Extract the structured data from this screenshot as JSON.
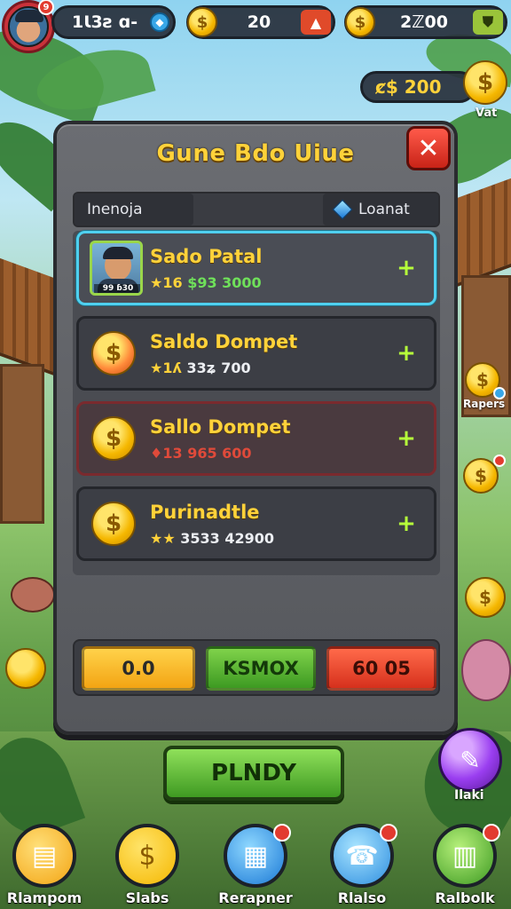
{
  "topbar": {
    "avatar_badge": "9",
    "player_value": "1Ɩ3ƨ ɑ-",
    "coins_value": "20",
    "gold_value": "2ℤ00"
  },
  "floating_chip": {
    "value": "ȼ$ 200",
    "label": "Vat"
  },
  "panel": {
    "title": "Gune Bdo Uiue",
    "close_symbol": "✕",
    "tabs": [
      {
        "label": "Inenoja"
      },
      {
        "label": "Loanat"
      }
    ],
    "rows": [
      {
        "title": "Sado Patal",
        "portrait_tag": "99 ɓ30",
        "sub_prefix": "★16",
        "sub_value": "$93 3000",
        "plus": "+"
      },
      {
        "title": "Saldo Dompet",
        "sub_prefix": "★1ʎ",
        "sub_value": "33ʑ 700",
        "plus": "+"
      },
      {
        "title": "Sallo Dompet",
        "sub_prefix": "♦13",
        "sub_value": "965 600",
        "plus": "+"
      },
      {
        "title": "Purinadtle",
        "sub_prefix": "★★",
        "sub_value": "3533 42900",
        "plus": "+"
      }
    ],
    "buttons": [
      {
        "label": "0.0"
      },
      {
        "label": "KSMOX"
      },
      {
        "label": "60 05"
      }
    ]
  },
  "play_button": {
    "label": "PLNDY"
  },
  "side": {
    "papers_label": "Rapers",
    "orb_label": "Ilaki"
  },
  "bottom_nav": [
    {
      "label": "Rlampom",
      "icon": "chest-icon"
    },
    {
      "label": "Slabs",
      "icon": "coin-icon"
    },
    {
      "label": "Rerapner",
      "icon": "scroll-icon"
    },
    {
      "label": "Rlalso",
      "icon": "phone-icon"
    },
    {
      "label": "Ralbolk",
      "icon": "book-icon"
    }
  ],
  "colors": {
    "gold": "#ffd23a",
    "accent_cyan": "#4fd0ef",
    "green": "#6fe05a",
    "red": "#e04a3a"
  }
}
